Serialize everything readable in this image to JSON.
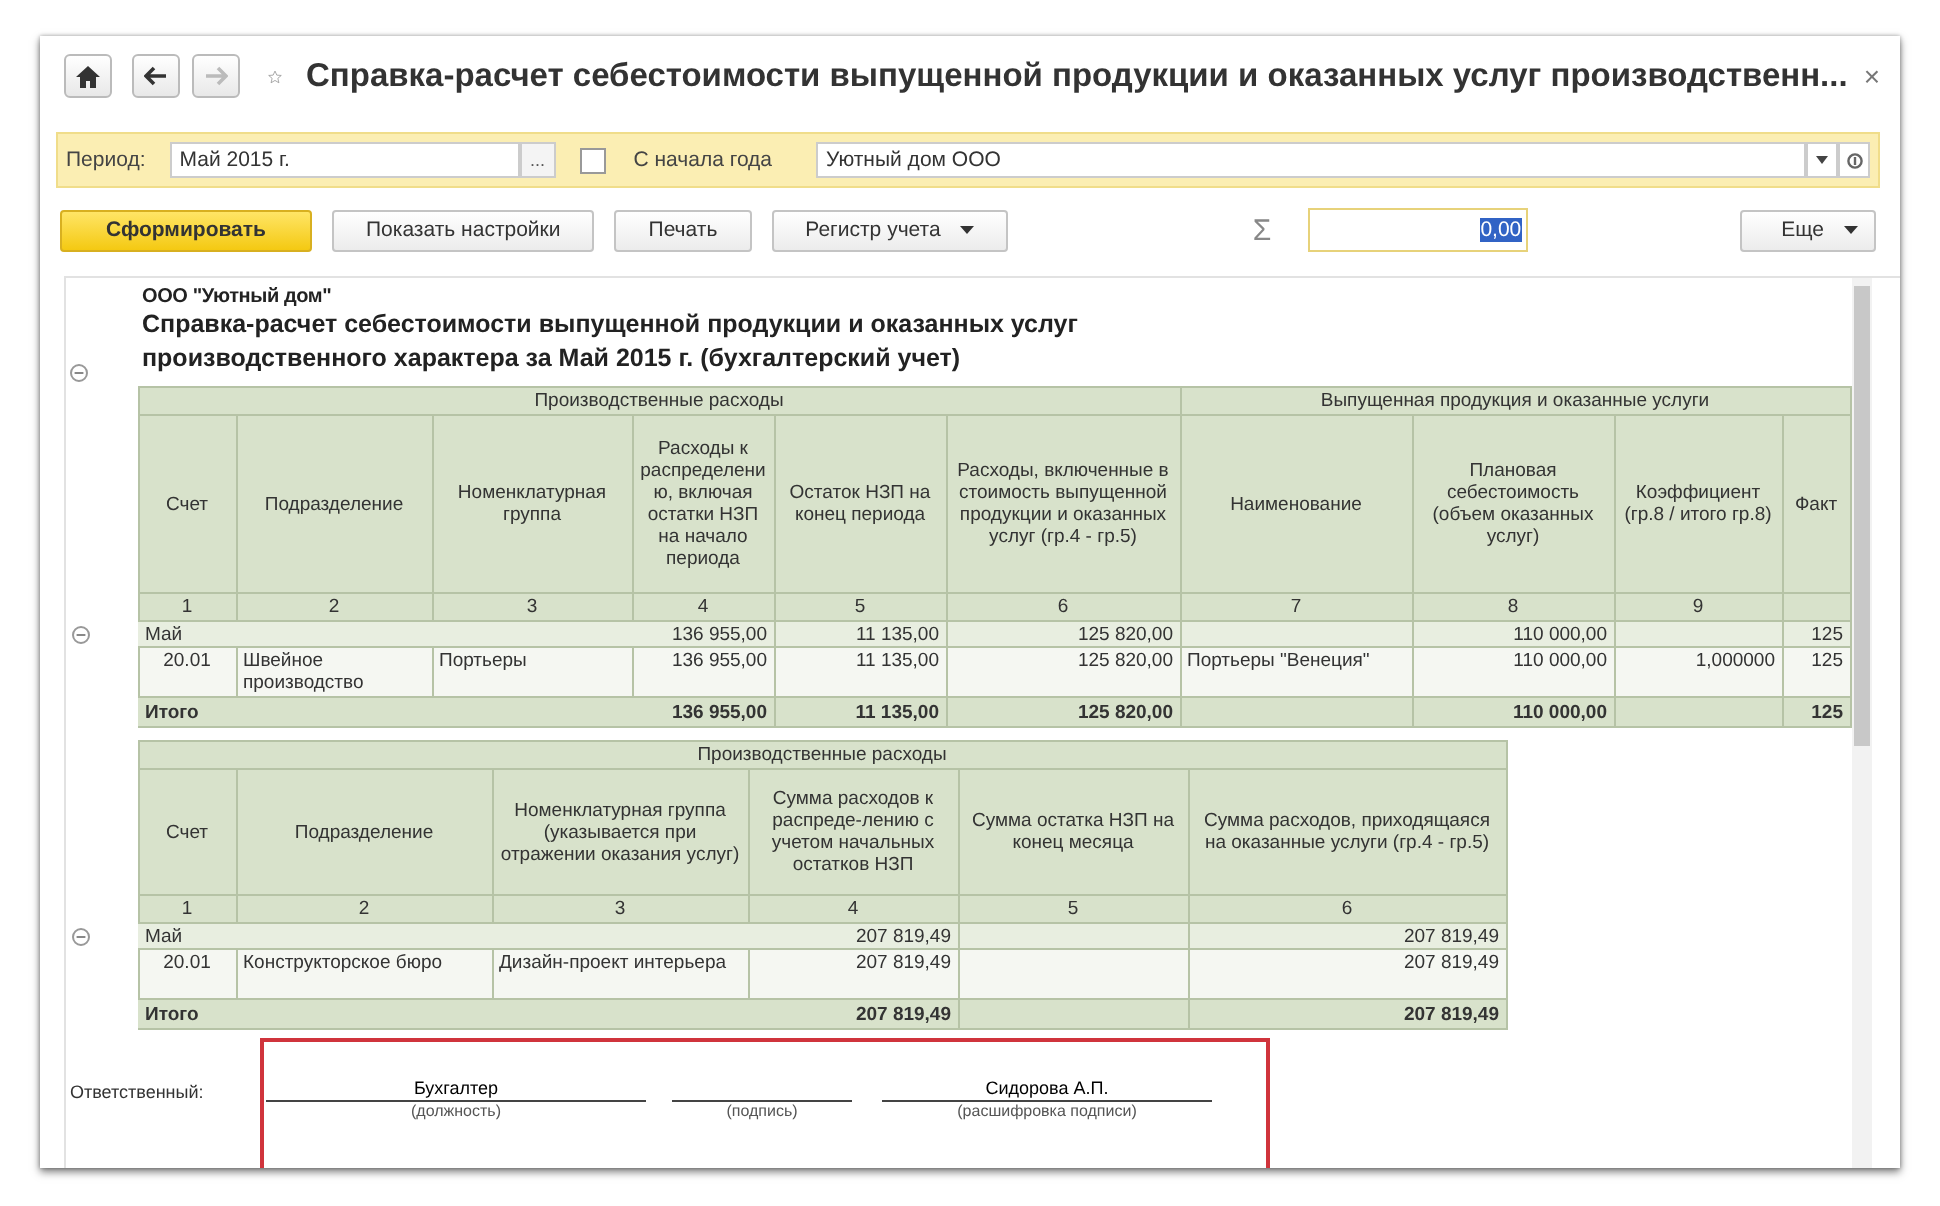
{
  "window": {
    "title": "Справка-расчет себестоимости выпущенной продукции и оказанных услуг производственн...",
    "close": "×",
    "favorite": false
  },
  "nav": [
    {
      "kind": "home",
      "disabled": false
    },
    {
      "kind": "back",
      "disabled": false
    },
    {
      "kind": "forward",
      "disabled": true
    }
  ],
  "filters": {
    "period_label": "Период:",
    "period_value": "Май 2015 г.",
    "pick_button": "...",
    "from_year_start": {
      "label": "С начала года",
      "checked": false
    },
    "organization": "Уютный дом ООО"
  },
  "toolbar": {
    "buttons": [
      {
        "label": "Сформировать",
        "kind": "primary"
      },
      {
        "label": "Показать настройки",
        "kind": "plain"
      },
      {
        "label": "Печать",
        "kind": "plain"
      },
      {
        "label": "Регистр учета",
        "kind": "menu"
      }
    ],
    "sum_sign": "Σ",
    "sum_value": "0,00",
    "sum_selected": true,
    "more": "Еще"
  },
  "report": {
    "company": "ООО \"Уютный дом\"",
    "title": "Справка-расчет себестоимости выпущенной продукции и оказанных услуг производственного характера  за Май 2015 г. (бухгалтерский учет)",
    "tables": [
      {
        "groups": [
          {
            "label": "Производственные расходы",
            "columns": [
              "Счет",
              "Подразделение",
              "Номенклатурная группа",
              "Расходы к распределению, включая остатки НЗП на начало периода",
              "Остаток НЗП на конец периода",
              "Расходы, включенные в стоимость выпущенной продукции и оказанных услуг (гр.4 - гр.5)"
            ]
          },
          {
            "label": "Выпущенная  продукция и оказанные услуги",
            "columns": [
              "Наименование",
              "Плановая себестоимость (объем оказанных услуг)",
              "Коэффициент (гр.8 / итого гр.8)",
              "Факт"
            ]
          }
        ],
        "numbers": [
          "1",
          "2",
          "3",
          "4",
          "5",
          "6",
          "7",
          "8",
          "9"
        ],
        "rows": [
          {
            "kind": "group",
            "expanded": true,
            "cells": [
              "Май",
              null,
              null,
              "136 955,00",
              "11 135,00",
              "125 820,00",
              null,
              "110 000,00",
              null,
              "125"
            ]
          },
          {
            "kind": "item",
            "cells": [
              "20.01",
              "Швейное производство",
              "Портьеры",
              "136 955,00",
              "11 135,00",
              "125 820,00",
              "Портьеры \"Венеция\"",
              "110 000,00",
              "1,000000",
              "125"
            ]
          },
          {
            "kind": "total",
            "cells": [
              "Итого",
              null,
              null,
              "136 955,00",
              "11 135,00",
              "125 820,00",
              null,
              "110 000,00",
              null,
              "125"
            ]
          }
        ]
      },
      {
        "groups": [
          {
            "label": "Производственные расходы",
            "columns": [
              "Счет",
              "Подразделение",
              "Номенклатурная группа (указывается при отражении оказания услуг)",
              "Сумма расходов к распреде-лению с учетом начальных остатков НЗП",
              "Сумма остатка НЗП на конец месяца",
              "Сумма расходов, приходящаяся на оказанные услуги  (гр.4 - гр.5)"
            ]
          }
        ],
        "numbers": [
          "1",
          "2",
          "3",
          "4",
          "5",
          "6"
        ],
        "rows": [
          {
            "kind": "group",
            "expanded": true,
            "cells": [
              "Май",
              null,
              null,
              "207 819,49",
              null,
              "207 819,49"
            ]
          },
          {
            "kind": "item",
            "cells": [
              "20.01",
              "Конструкторское бюро",
              "Дизайн-проект интерьера",
              "207 819,49",
              null,
              "207 819,49"
            ]
          },
          {
            "kind": "total",
            "cells": [
              "Итого",
              null,
              null,
              "207 819,49",
              null,
              "207 819,49"
            ]
          }
        ]
      }
    ],
    "signature": {
      "label": "Ответственный:",
      "position": "Бухгалтер",
      "position_hint": "(должность)",
      "sign_hint": "(подпись)",
      "name": "Сидорова А.П.",
      "name_hint": "(расшифровка подписи)"
    }
  }
}
